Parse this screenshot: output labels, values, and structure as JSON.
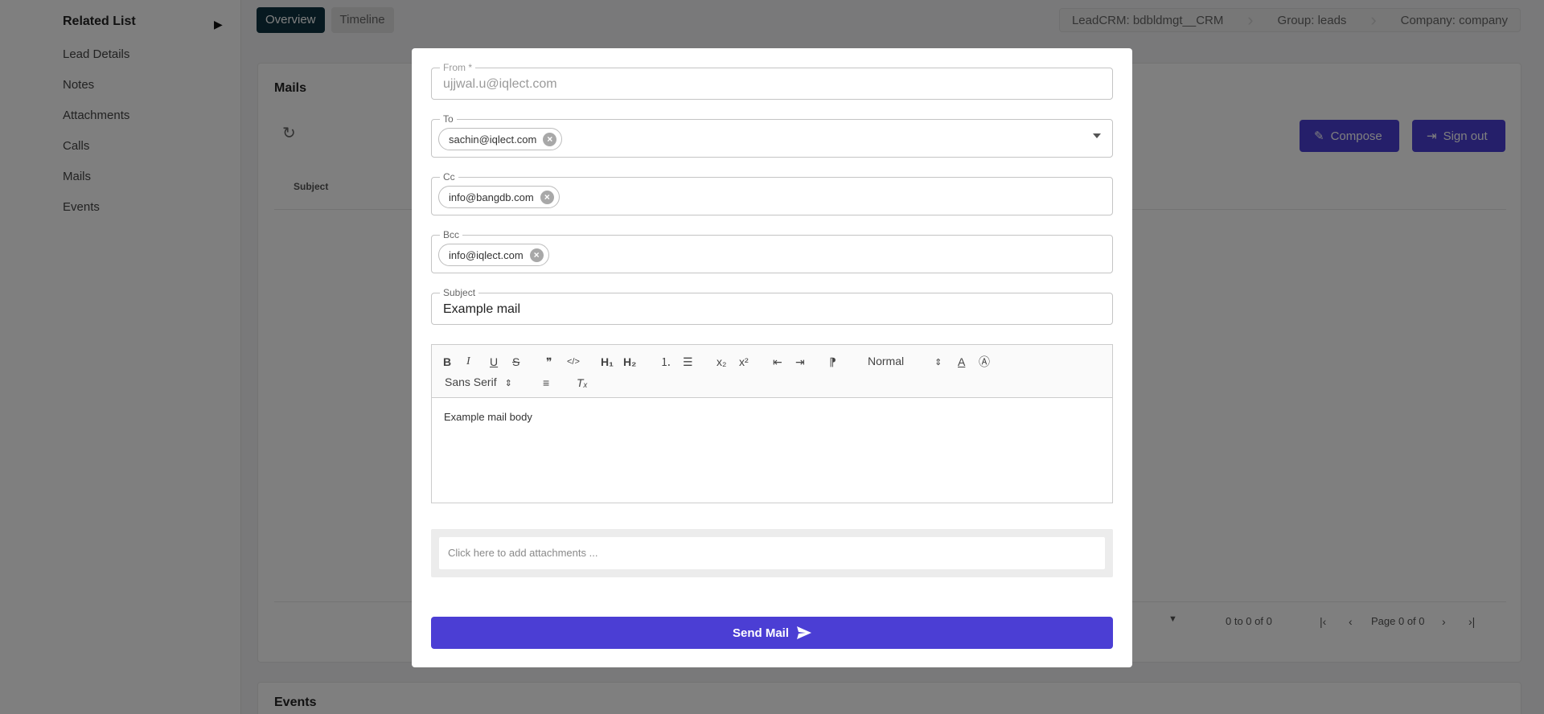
{
  "sidebar": {
    "title": "Related List",
    "items": [
      "Lead Details",
      "Notes",
      "Attachments",
      "Calls",
      "Mails",
      "Events"
    ]
  },
  "tabs": [
    {
      "label": "Overview",
      "active": true
    },
    {
      "label": "Timeline",
      "active": false
    }
  ],
  "breadcrumb": [
    "LeadCRM: bdbldmgt__CRM",
    "Group: leads",
    "Company: company"
  ],
  "mails_card": {
    "title": "Mails",
    "column_subject": "Subject",
    "compose_label": "Compose",
    "signout_label": "Sign out",
    "pager_range": "0 to 0 of 0",
    "pager_page": "Page 0 of 0"
  },
  "events_card": {
    "title": "Events"
  },
  "modal": {
    "from_label": "From *",
    "from_value": "ujjwal.u@iqlect.com",
    "to_label": "To",
    "to_chip": "sachin@iqlect.com",
    "cc_label": "Cc",
    "cc_chip": "info@bangdb.com",
    "bcc_label": "Bcc",
    "bcc_chip": "info@iqlect.com",
    "subject_label": "Subject",
    "subject_value": "Example mail",
    "toolbar": {
      "bold": "B",
      "italic": "I",
      "underline": "U",
      "strike": "S",
      "quote": "❞",
      "code": "</>",
      "h1": "H₁",
      "h2": "H₂",
      "ordered_list": "⒈",
      "bullet_list": "☰",
      "subscript": "x₂",
      "superscript": "x²",
      "outdent": "⇤",
      "indent": "⇥",
      "rtl": "⁋",
      "size": "Normal",
      "color": "A",
      "background": "Ⓐ",
      "font": "Sans Serif",
      "align": "≡",
      "clean": "Tₓ"
    },
    "body_text": "Example mail body",
    "attach_text": "Click here to add attachments ...",
    "send_label": "Send Mail"
  },
  "colors": {
    "primary": "#4b3ed4",
    "tab_active": "#0f3340",
    "backdrop": "rgba(0,0,0,0.5)"
  }
}
